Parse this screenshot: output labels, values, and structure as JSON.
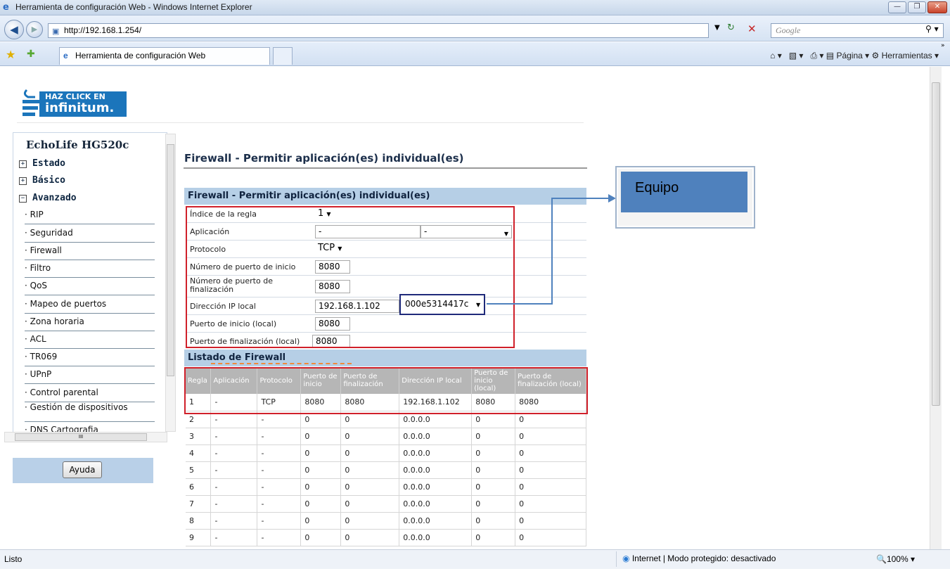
{
  "window": {
    "title": "Herramienta de configuración Web - Windows Internet Explorer"
  },
  "browser": {
    "url": "http://192.168.1.254/",
    "search_placeholder": "Google",
    "tab_title": "Herramienta de configuración Web",
    "cmd_pagina": "Página",
    "cmd_herramientas": "Herramientas",
    "overflow": "»"
  },
  "banner": {
    "line1": "HAZ CLICK EN",
    "line2": "infinitum."
  },
  "sidebar": {
    "title": "EchoLife HG520c",
    "headers": [
      "Estado",
      "Básico",
      "Avanzado"
    ],
    "items": [
      "RIP",
      "Seguridad",
      "Firewall",
      "Filtro",
      "QoS",
      "Mapeo de puertos",
      "Zona horaria",
      "ACL",
      "TR069",
      "UPnP",
      "Control parental",
      "Gestión de dispositivos",
      "DNS Cartografia"
    ],
    "help_button": "Ayuda",
    "scroll_mark": "III"
  },
  "main": {
    "page_title": "Firewall - Permitir aplicación(es) individual(es)",
    "section_title": "Firewall - Permitir aplicación(es) individual(es)",
    "form": {
      "labels": {
        "indice": "Índice de la regla",
        "aplicacion": "Aplicación",
        "protocolo": "Protocolo",
        "puerto_inicio": "Número de puerto de inicio",
        "puerto_fin": "Número de puerto de finalización",
        "ip_local": "Dirección IP local",
        "puerto_inicio_local": "Puerto de inicio (local)",
        "puerto_fin_local": "Puerto de finalización (local)"
      },
      "values": {
        "indice": "1",
        "aplicacion_1": "-",
        "aplicacion_2": "-",
        "protocolo": "TCP",
        "puerto_inicio": "8080",
        "puerto_fin": "8080",
        "ip_local": "192.168.1.102",
        "equipo_select": "000e5314417c",
        "puerto_inicio_local": "8080",
        "puerto_fin_local": "8080"
      }
    },
    "list_title": "Listado de Firewall",
    "table": {
      "headers": [
        "Regla",
        "Aplicación",
        "Protocolo",
        "Puerto de inicio",
        "Puerto de finalización",
        "Dirección IP local",
        "Puerto de inicio (local)",
        "Puerto de finalización (local)"
      ],
      "rows": [
        [
          "1",
          "-",
          "TCP",
          "8080",
          "8080",
          "192.168.1.102",
          "8080",
          "8080"
        ],
        [
          "2",
          "-",
          "-",
          "0",
          "0",
          "0.0.0.0",
          "0",
          "0"
        ],
        [
          "3",
          "-",
          "-",
          "0",
          "0",
          "0.0.0.0",
          "0",
          "0"
        ],
        [
          "4",
          "-",
          "-",
          "0",
          "0",
          "0.0.0.0",
          "0",
          "0"
        ],
        [
          "5",
          "-",
          "-",
          "0",
          "0",
          "0.0.0.0",
          "0",
          "0"
        ],
        [
          "6",
          "-",
          "-",
          "0",
          "0",
          "0.0.0.0",
          "0",
          "0"
        ],
        [
          "7",
          "-",
          "-",
          "0",
          "0",
          "0.0.0.0",
          "0",
          "0"
        ],
        [
          "8",
          "-",
          "-",
          "0",
          "0",
          "0.0.0.0",
          "0",
          "0"
        ],
        [
          "9",
          "-",
          "-",
          "0",
          "0",
          "0.0.0.0",
          "0",
          "0"
        ]
      ]
    }
  },
  "annotation": {
    "label": "Equipo",
    "color": "#4f81bd",
    "highlight_color": "#d0202a"
  },
  "status": {
    "left": "Listo",
    "zone": "Internet | Modo protegido: desactivado",
    "zoom": "100%"
  }
}
